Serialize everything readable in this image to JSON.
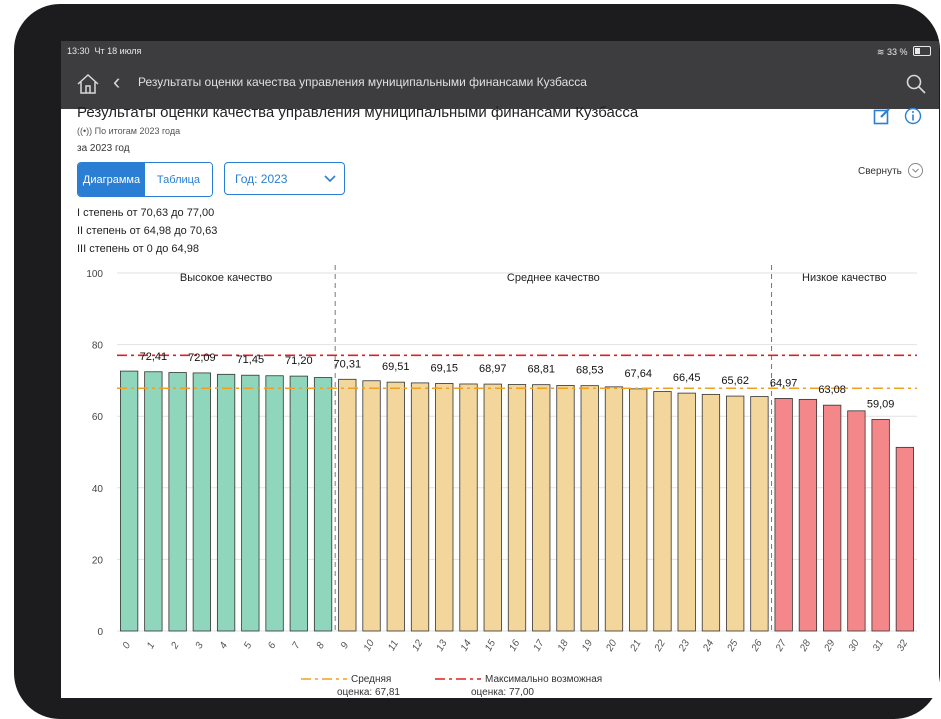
{
  "status": {
    "time": "13:30",
    "date": "Чт 18 июля",
    "battery": "33 %"
  },
  "nav": {
    "title": "Результаты оценки качества управления муниципальными финансами  Кузбасса"
  },
  "header": {
    "title": "Результаты оценки качества управления муниципальными финансами  Кузбасса",
    "subtitle": "((•)) По итогам 2023 года",
    "period": "за 2023 год",
    "collapse_label": "Свернуть"
  },
  "view_tabs": [
    {
      "label": "Диаграмма",
      "active": true
    },
    {
      "label": "Таблица",
      "active": false
    }
  ],
  "year_select": {
    "value": "Год: 2023"
  },
  "degrees": [
    "I степень от 70,63 до 77,00",
    "II степень от 64,98 до 70,63",
    "III степень от 0 до 64,98"
  ],
  "colors": {
    "accent": "#2a7fd4",
    "high": "#8fd6bc",
    "medium": "#f3d69b",
    "low": "#f4878a",
    "avg_line": "#f0a020",
    "max_line": "#e02020"
  },
  "icons": {
    "home": "home-icon",
    "back": "chevron-left-icon",
    "search": "search-icon",
    "edit": "edit-icon",
    "info": "info-icon",
    "collapse": "chevron-down-circle-icon",
    "dropdown": "chevron-down-icon"
  },
  "chart_data": {
    "type": "bar",
    "categories": [
      "0",
      "1",
      "2",
      "3",
      "4",
      "5",
      "6",
      "7",
      "8",
      "9",
      "10",
      "11",
      "12",
      "13",
      "14",
      "15",
      "16",
      "17",
      "18",
      "19",
      "20",
      "21",
      "22",
      "23",
      "24",
      "25",
      "26",
      "27",
      "28",
      "29",
      "30",
      "31",
      "32"
    ],
    "values": [
      72.6,
      72.41,
      72.2,
      72.09,
      71.7,
      71.45,
      71.3,
      71.2,
      70.8,
      70.31,
      69.9,
      69.51,
      69.3,
      69.15,
      69.0,
      68.97,
      68.85,
      68.81,
      68.6,
      68.53,
      68.2,
      67.64,
      66.9,
      66.45,
      66.1,
      65.62,
      65.5,
      64.97,
      64.7,
      63.08,
      61.5,
      59.09,
      51.3
    ],
    "groups": [
      "high",
      "high",
      "high",
      "high",
      "high",
      "high",
      "high",
      "high",
      "high",
      "medium",
      "medium",
      "medium",
      "medium",
      "medium",
      "medium",
      "medium",
      "medium",
      "medium",
      "medium",
      "medium",
      "medium",
      "medium",
      "medium",
      "medium",
      "medium",
      "medium",
      "medium",
      "low",
      "low",
      "low",
      "low",
      "low",
      "low"
    ],
    "labels": [
      {
        "index": 1,
        "text": "72,41"
      },
      {
        "index": 3,
        "text": "72,09"
      },
      {
        "index": 5,
        "text": "71,45"
      },
      {
        "index": 7,
        "text": "71,20"
      },
      {
        "index": 9,
        "text": "70,31"
      },
      {
        "index": 11,
        "text": "69,51"
      },
      {
        "index": 13,
        "text": "69,15"
      },
      {
        "index": 15,
        "text": "68,97"
      },
      {
        "index": 17,
        "text": "68,81"
      },
      {
        "index": 19,
        "text": "68,53"
      },
      {
        "index": 21,
        "text": "67,64"
      },
      {
        "index": 23,
        "text": "66,45"
      },
      {
        "index": 25,
        "text": "65,62"
      },
      {
        "index": 27,
        "text": "64,97"
      },
      {
        "index": 29,
        "text": "63,08"
      },
      {
        "index": 31,
        "text": "59,09"
      }
    ],
    "group_titles": [
      "Высокое качество",
      "Среднее качество",
      "Низкое качество"
    ],
    "group_bounds": [
      0,
      9,
      27,
      33
    ],
    "ylim": [
      0,
      100
    ],
    "yticks": [
      0,
      20,
      40,
      60,
      80,
      100
    ],
    "avg_value": 67.81,
    "max_value": 77.0,
    "legend": [
      {
        "line1": "Средняя",
        "line2": "оценка: 67,81",
        "color": "#f0a020"
      },
      {
        "line1": "Максимально возможная",
        "line2": "оценка: 77,00",
        "color": "#e02020"
      }
    ]
  }
}
